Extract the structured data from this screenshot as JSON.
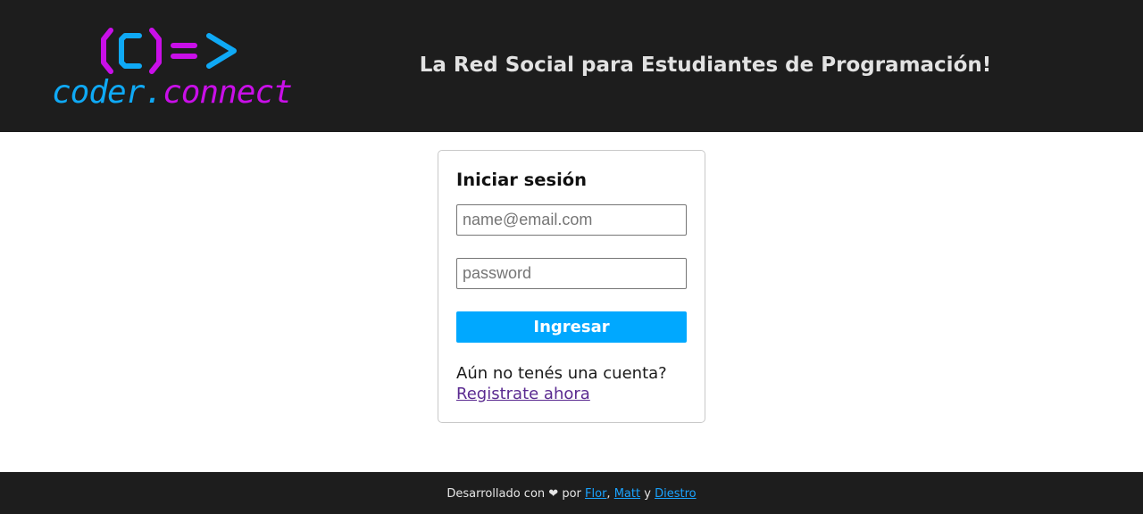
{
  "header": {
    "logo": {
      "symbol": "(C)=>",
      "text_part1": "coder",
      "text_dot": ".",
      "text_part2": "connect",
      "colors": {
        "coder": "#0fa9f5",
        "connect": "#c90fe8"
      }
    },
    "tagline": "La Red Social para Estudiantes de Programación!",
    "background": "#1d1d1d"
  },
  "login": {
    "title": "Iniciar sesión",
    "email_placeholder": "name@email.com",
    "email_value": "",
    "password_placeholder": "password",
    "password_value": "",
    "submit_label": "Ingresar",
    "signup_prompt": "Aún no tenés una cuenta?",
    "signup_link": "Registrate ahora",
    "accent": "#00a8ff"
  },
  "footer": {
    "prefix": "Desarrollado con",
    "heart_icon": "heart-icon",
    "por": "por",
    "authors": [
      "Flor",
      "Matt",
      "Diestro"
    ],
    "sep1": ",",
    "sep2": "y"
  }
}
